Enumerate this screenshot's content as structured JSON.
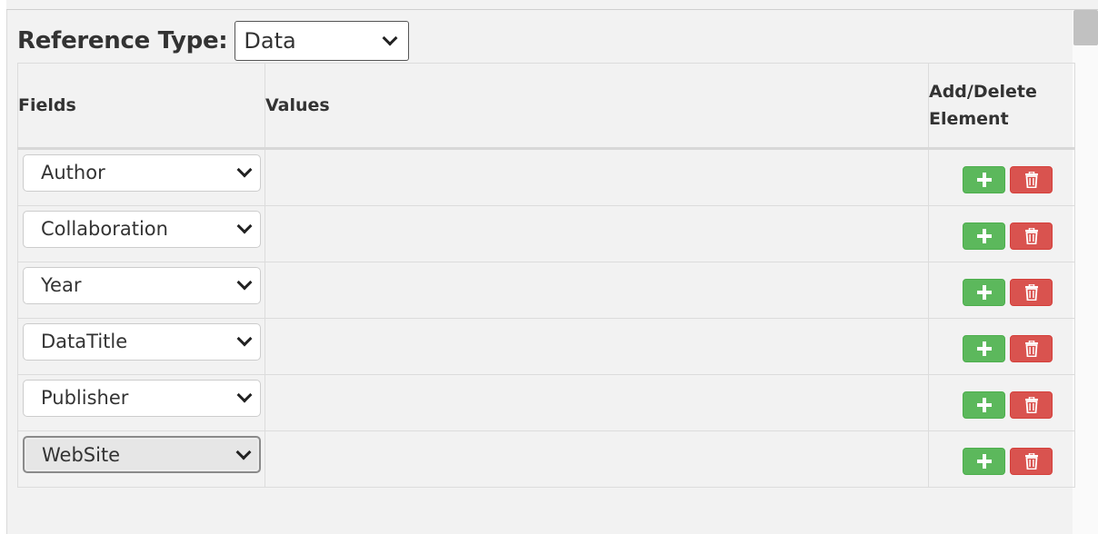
{
  "reference": {
    "label": "Reference Type:",
    "selected": "Data"
  },
  "table": {
    "headers": {
      "fields": "Fields",
      "values": "Values",
      "actions_line1": "Add/Delete",
      "actions_line2": "Element"
    },
    "rows": [
      {
        "field": "Author",
        "value": ""
      },
      {
        "field": "Collaboration",
        "value": ""
      },
      {
        "field": "Year",
        "value": ""
      },
      {
        "field": "DataTitle",
        "value": ""
      },
      {
        "field": "Publisher",
        "value": ""
      },
      {
        "field": "WebSite",
        "value": ""
      }
    ]
  },
  "icons": {
    "add": "plus-icon",
    "delete": "trash-icon",
    "dropdown": "chevron-down-icon"
  },
  "colors": {
    "add_button": "#5cb85c",
    "delete_button": "#d9534f",
    "background": "#f2f2f2"
  }
}
